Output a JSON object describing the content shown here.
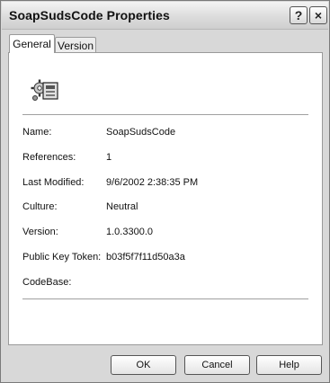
{
  "window": {
    "title": "SoapSudsCode Properties",
    "help_glyph": "?",
    "close_glyph": "×"
  },
  "tabs": [
    {
      "label": "General",
      "selected": true
    },
    {
      "label": "Version",
      "selected": false
    }
  ],
  "icon": "assembly-icon",
  "properties": [
    {
      "label": "Name:",
      "value": "SoapSudsCode"
    },
    {
      "label": "References:",
      "value": "1"
    },
    {
      "label": "Last Modified:",
      "value": "9/6/2002 2:38:35 PM"
    },
    {
      "label": "Culture:",
      "value": "Neutral"
    },
    {
      "label": "Version:",
      "value": "1.0.3300.0"
    },
    {
      "label": "Public Key Token:",
      "value": "b03f5f7f11d50a3a"
    },
    {
      "label": "CodeBase:",
      "value": ""
    }
  ],
  "buttons": {
    "ok": "OK",
    "cancel": "Cancel",
    "help": "Help"
  }
}
